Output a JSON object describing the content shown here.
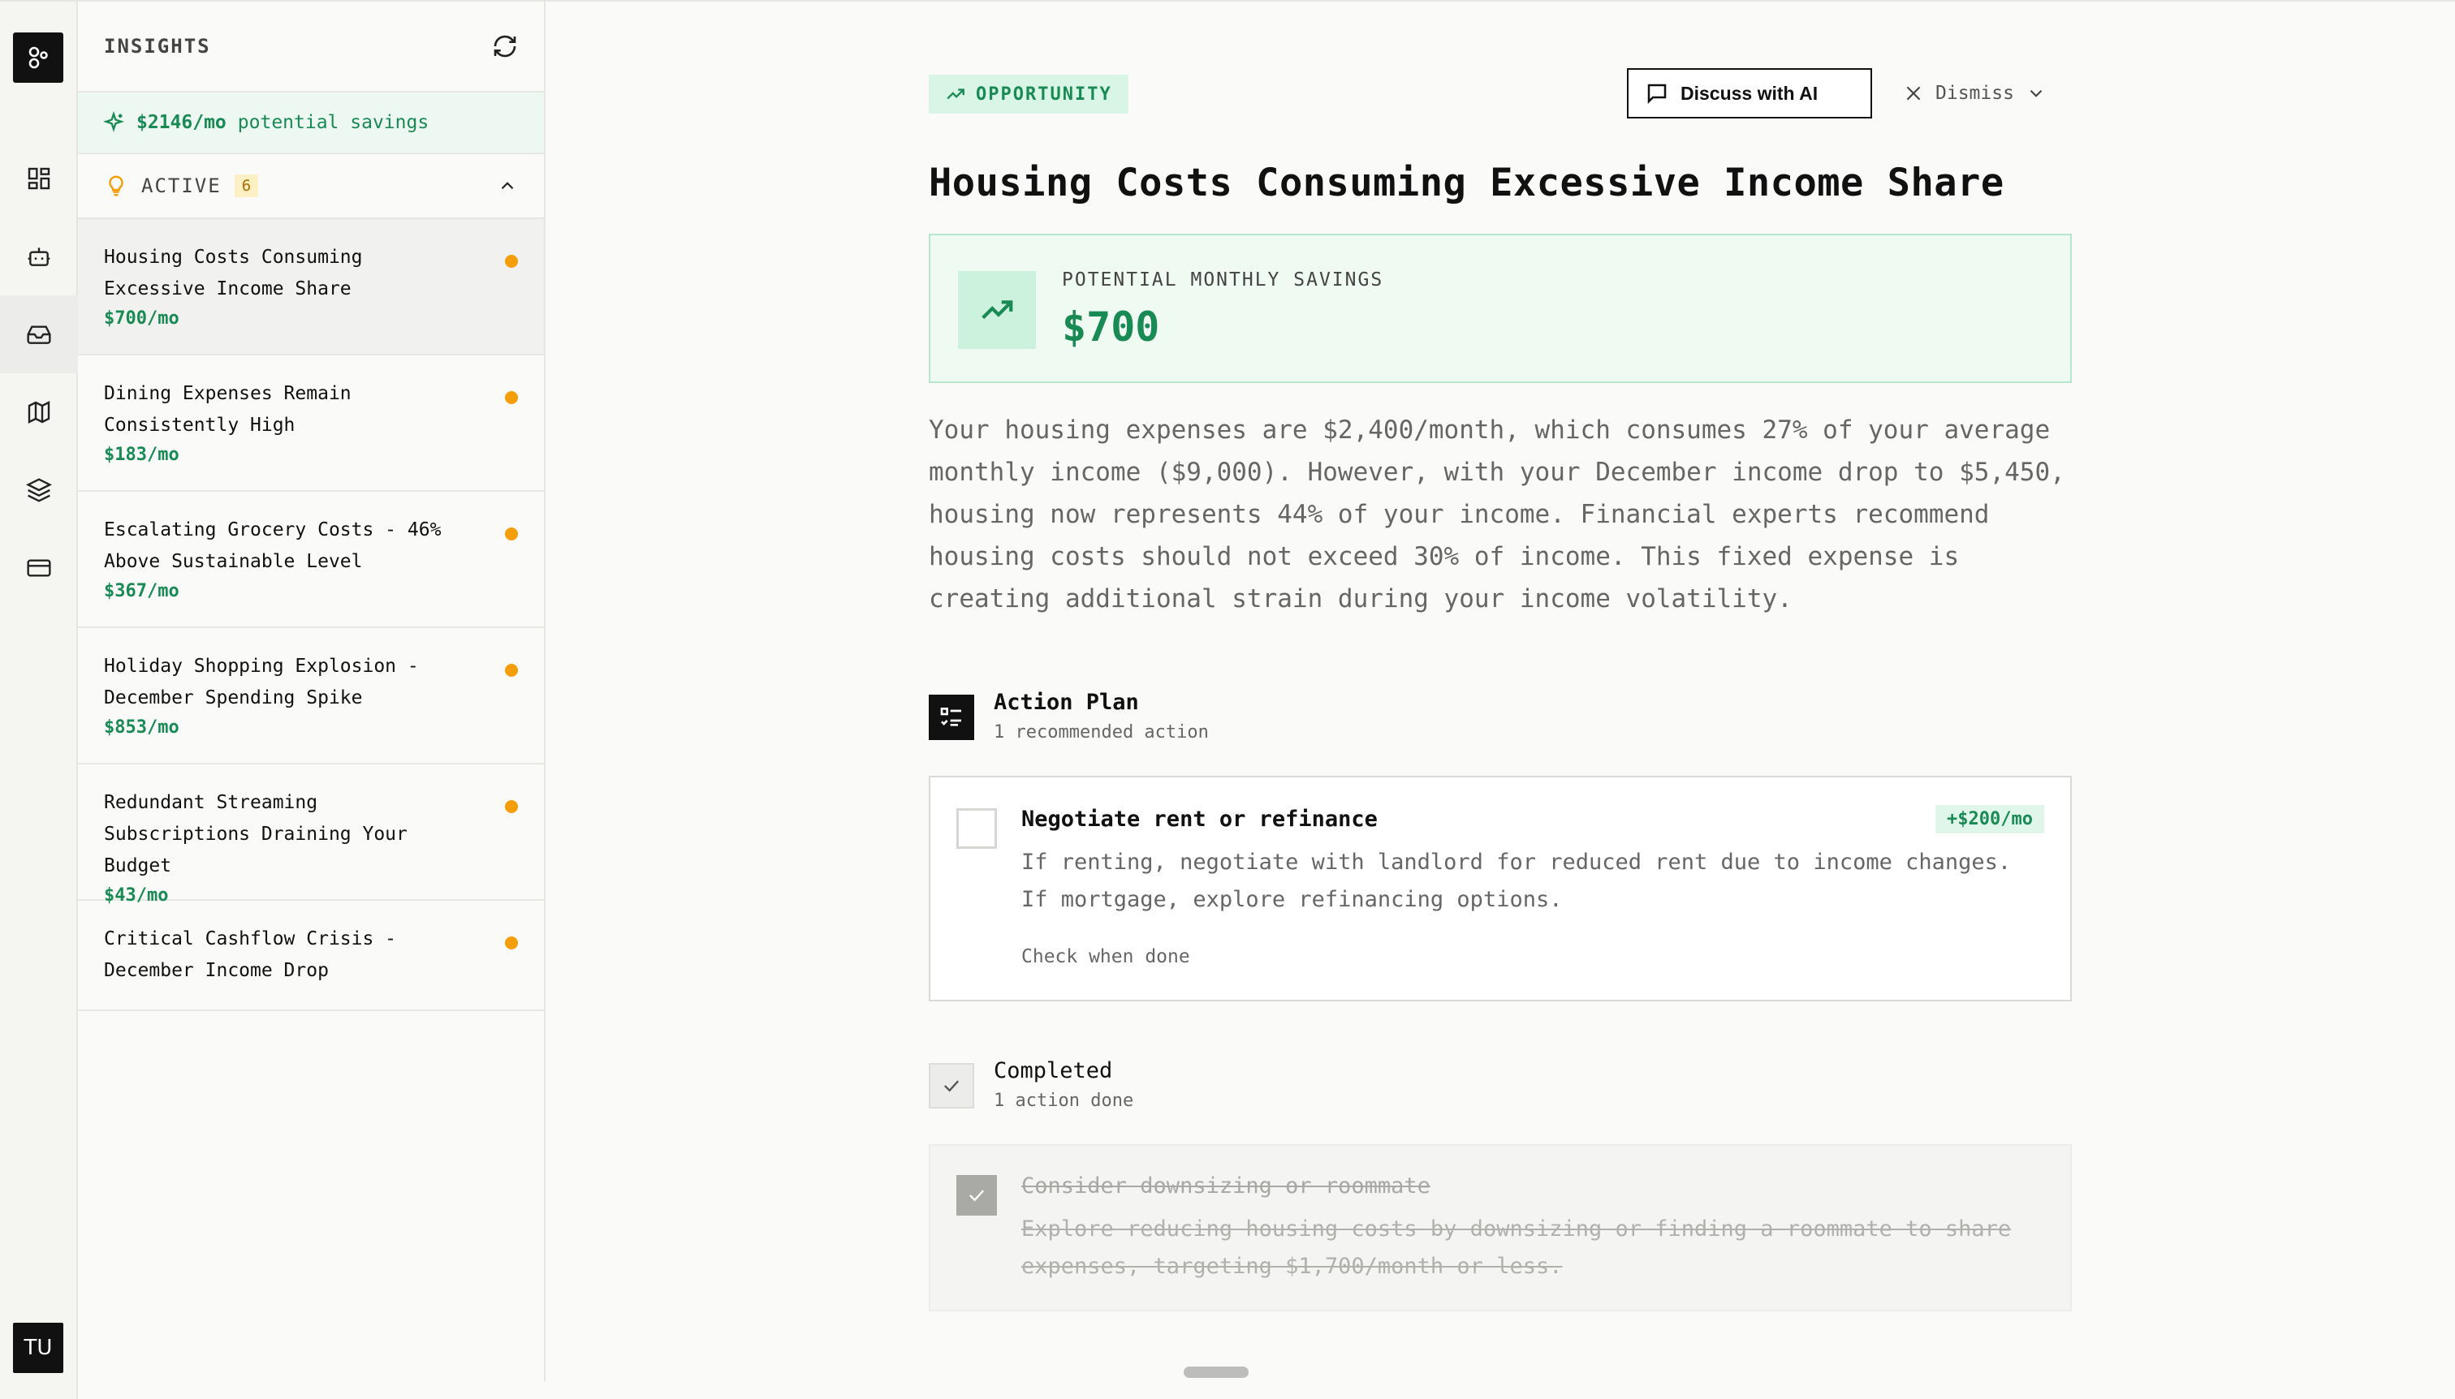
{
  "rail": {
    "avatar_initials": "TU",
    "nav_icons": [
      "dashboard-icon",
      "bot-icon",
      "inbox-icon",
      "map-icon",
      "layers-icon",
      "card-icon"
    ],
    "active_nav": "inbox-icon"
  },
  "panel": {
    "title": "INSIGHTS",
    "savings_amount": "$2146/mo",
    "savings_text": "potential savings",
    "active_label": "ACTIVE",
    "active_count": "6",
    "items": [
      {
        "title": "Housing Costs Consuming Excessive Income Share",
        "amount": "$700/mo"
      },
      {
        "title": "Dining Expenses Remain Consistently High",
        "amount": "$183/mo"
      },
      {
        "title": "Escalating Grocery Costs - 46% Above Sustainable Level",
        "amount": "$367/mo"
      },
      {
        "title": "Holiday Shopping Explosion - December Spending Spike",
        "amount": "$853/mo"
      },
      {
        "title": "Redundant Streaming Subscriptions Draining Your Budget",
        "amount": "$43/mo"
      },
      {
        "title": "Critical Cashflow Crisis - December Income Drop",
        "amount": ""
      }
    ]
  },
  "main": {
    "chip": "OPPORTUNITY",
    "discuss_label": "Discuss with AI",
    "dismiss_label": "Dismiss",
    "headline": "Housing Costs Consuming Excessive Income Share",
    "savings_label": "POTENTIAL MONTHLY SAVINGS",
    "savings_value": "$700",
    "description": "Your housing expenses are $2,400/month, which consumes 27% of your average monthly income ($9,000). However, with your December income drop to $5,450, housing now represents 44% of your income. Financial experts recommend housing costs should not exceed 30% of income. This fixed expense is creating additional strain during your income volatility.",
    "action_plan": {
      "title": "Action Plan",
      "subtitle": "1 recommended action",
      "actions": [
        {
          "title": "Negotiate rent or refinance",
          "badge": "+$200/mo",
          "description": "If renting, negotiate with landlord for reduced rent due to income changes. If mortgage, explore refinancing options.",
          "hint": "Check when done"
        }
      ]
    },
    "completed": {
      "title": "Completed",
      "subtitle": "1 action done",
      "actions": [
        {
          "title": "Consider downsizing or roommate",
          "description": "Explore reducing housing costs by downsizing or finding a roommate to share expenses, targeting $1,700/month or less."
        }
      ]
    }
  },
  "colors": {
    "accent_green": "#1a8a55",
    "status_dot": "#f59e0b",
    "badge_bg": "#fdf0c4"
  }
}
